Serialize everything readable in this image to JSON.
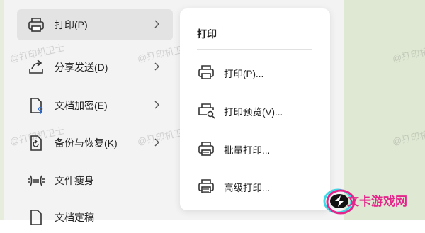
{
  "menu": {
    "items": [
      {
        "label": "打印(P)",
        "icon": "printer-icon",
        "has_submenu": true,
        "active": true
      },
      {
        "label": "分享发送(D)",
        "icon": "share-icon",
        "has_submenu": true
      },
      {
        "label": "文档加密(E)",
        "icon": "document-lock-icon",
        "has_submenu": true
      },
      {
        "label": "备份与恢复(K)",
        "icon": "backup-icon",
        "has_submenu": true
      },
      {
        "label": "文件瘦身",
        "icon": "file-slim-icon",
        "has_submenu": false
      },
      {
        "label": "文档定稿",
        "icon": "document-finalize-icon",
        "has_submenu": false
      }
    ]
  },
  "submenu": {
    "title": "打印",
    "items": [
      {
        "label": "打印(P)...",
        "icon": "printer-icon"
      },
      {
        "label": "打印预览(V)...",
        "icon": "print-preview-icon"
      },
      {
        "label": "批量打印...",
        "icon": "batch-print-icon"
      },
      {
        "label": "高级打印...",
        "icon": "advanced-print-icon"
      }
    ]
  },
  "watermark_text": "@打印机卫士",
  "brand": {
    "text": "文卡游戏网",
    "color": "#e4268b"
  }
}
